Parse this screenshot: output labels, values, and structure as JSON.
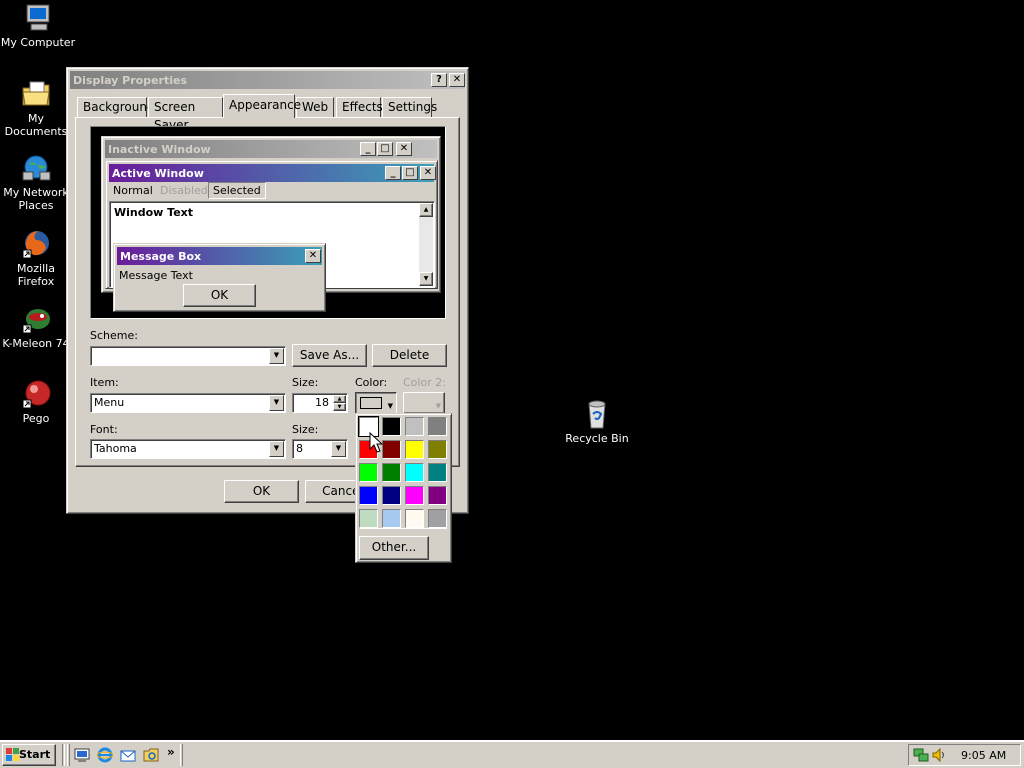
{
  "desktop": {
    "icons": [
      {
        "label": "My Computer",
        "icon": "computer-icon"
      },
      {
        "label": "My Documents",
        "icon": "folder-documents-icon"
      },
      {
        "label": "My Network Places",
        "icon": "network-icon"
      },
      {
        "label": "Mozilla Firefox",
        "icon": "firefox-icon"
      },
      {
        "label": "K-Meleon 74",
        "icon": "kmeleon-icon"
      },
      {
        "label": "Pego",
        "icon": "pego-icon"
      },
      {
        "label": "Recycle Bin",
        "icon": "recycle-bin-icon"
      }
    ]
  },
  "dialog": {
    "title": "Display Properties",
    "help_btn": "?",
    "close_btn": "✕",
    "tabs": [
      "Background",
      "Screen Saver",
      "Appearance",
      "Web",
      "Effects",
      "Settings"
    ],
    "selected_tab": "Appearance",
    "preview": {
      "inactive_title": "Inactive Window",
      "active_title": "Active Window",
      "menu_normal": "Normal",
      "menu_disabled": "Disabled",
      "menu_selected": "Selected",
      "window_text": "Window Text",
      "msgbox_title": "Message Box",
      "msgbox_text": "Message Text",
      "msgbox_ok": "OK"
    },
    "scheme_label": "Scheme:",
    "scheme_value": "",
    "save_as": "Save As...",
    "delete": "Delete",
    "item_label": "Item:",
    "item_value": "Menu",
    "size_label": "Size:",
    "size_value": "18",
    "color_label": "Color:",
    "color2_label": "Color 2:",
    "font_label": "Font:",
    "font_value": "Tahoma",
    "font_size_label": "Size:",
    "font_size_value": "8",
    "ok": "OK",
    "cancel": "Cancel"
  },
  "color_picker": {
    "swatches": [
      "#ffffff",
      "#000000",
      "#c0c0c0",
      "#808080",
      "#ff0000",
      "#800000",
      "#ffff00",
      "#808000",
      "#00ff00",
      "#008000",
      "#00ffff",
      "#008080",
      "#0000ff",
      "#000080",
      "#ff00ff",
      "#800080",
      "#c0dcc0",
      "#a6caf0",
      "#fffbf0",
      "#a0a0a4"
    ],
    "other": "Other..."
  },
  "taskbar": {
    "start": "Start",
    "quick_launch": [
      "desktop-icon",
      "ie-icon",
      "outlook-icon",
      "explorer-icon"
    ],
    "chevron": "»",
    "clock": "9:05 AM"
  }
}
